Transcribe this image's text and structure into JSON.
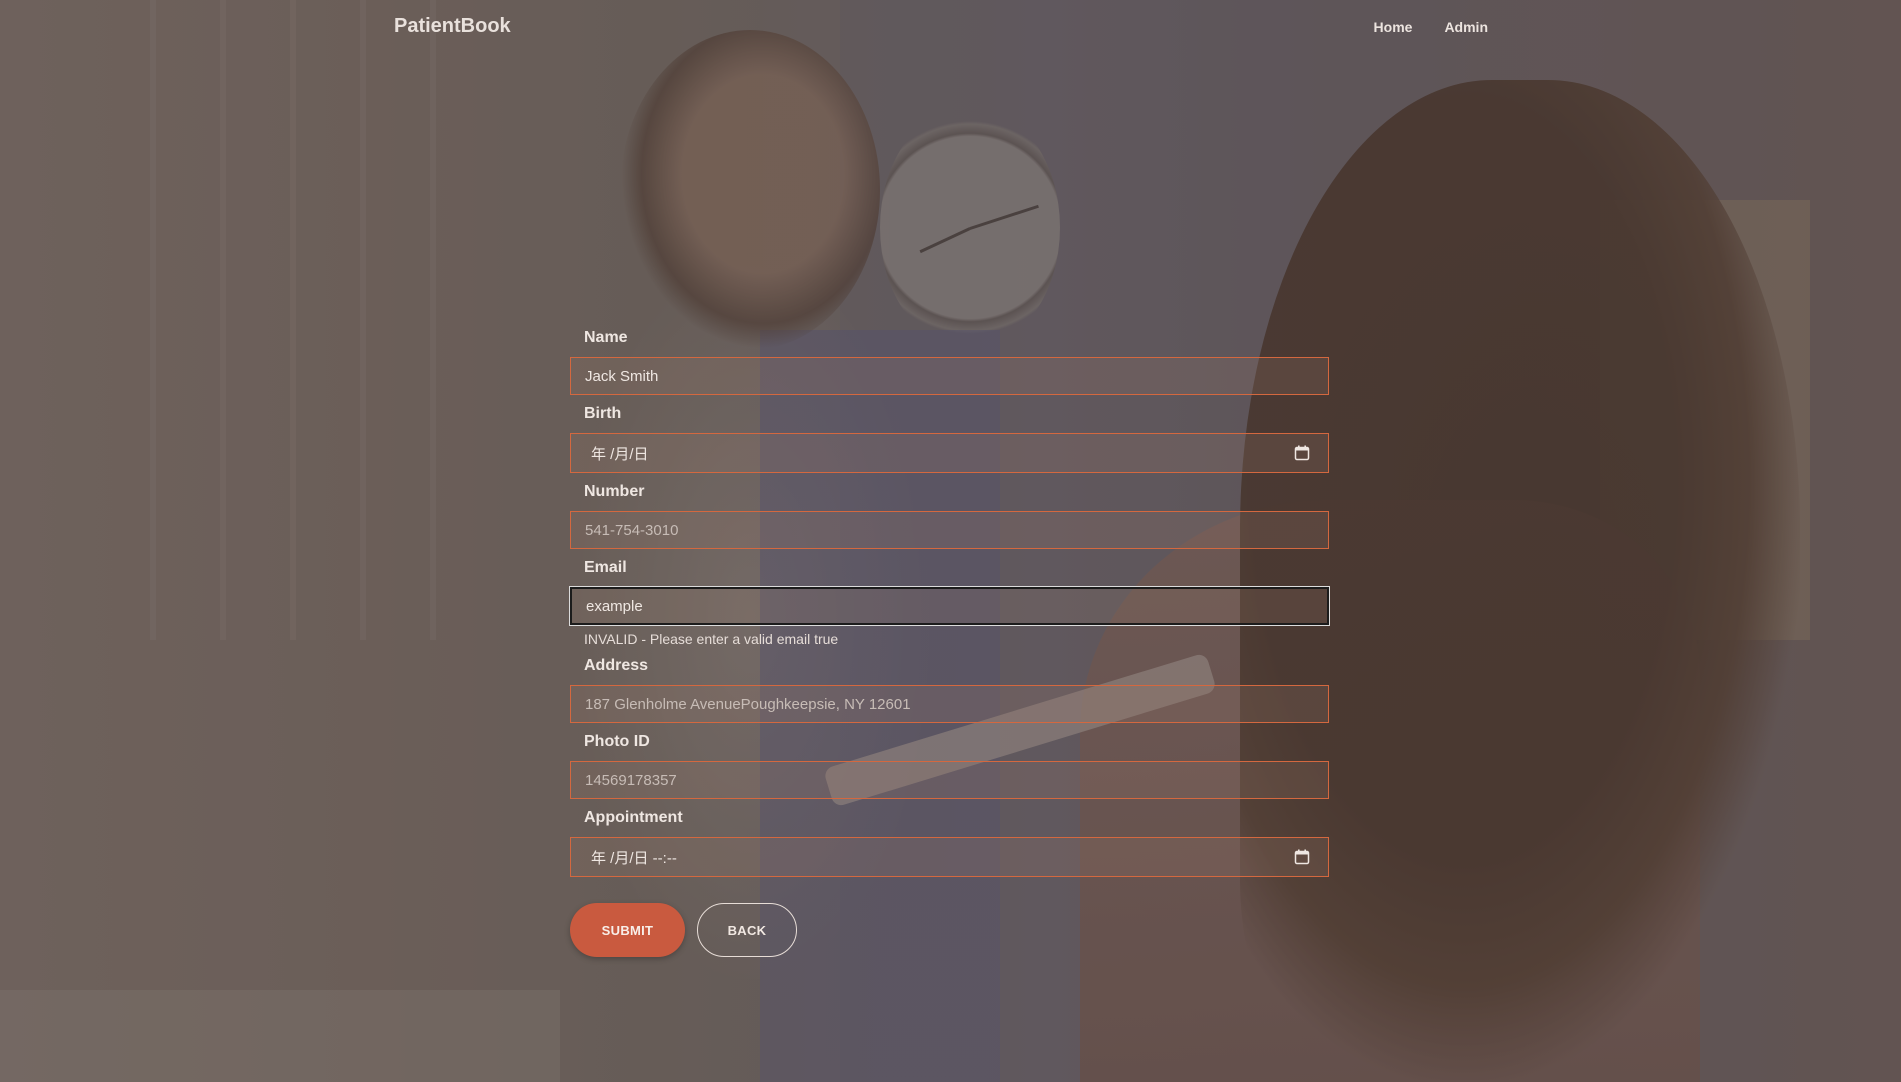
{
  "app": {
    "brand": "PatientBook"
  },
  "nav": {
    "home": "Home",
    "admin": "Admin"
  },
  "form": {
    "name": {
      "label": "Name",
      "value": "Jack Smith"
    },
    "birth": {
      "label": "Birth",
      "value": "年 /月/日"
    },
    "number": {
      "label": "Number",
      "placeholder": "541-754-3010"
    },
    "email": {
      "label": "Email",
      "value": "example",
      "error": "INVALID - Please enter a valid email true"
    },
    "address": {
      "label": "Address",
      "placeholder": "187 Glenholme AvenuePoughkeepsie, NY 12601"
    },
    "photo_id": {
      "label": "Photo ID",
      "placeholder": "14569178357"
    },
    "appointment": {
      "label": "Appointment",
      "value": "年 /月/日 --:--"
    }
  },
  "buttons": {
    "submit": "SUBMIT",
    "back": "BACK"
  },
  "icons": {
    "calendar": "calendar-icon"
  },
  "colors": {
    "accent": "#d4683f",
    "submit_bg": "#c95a3f"
  }
}
